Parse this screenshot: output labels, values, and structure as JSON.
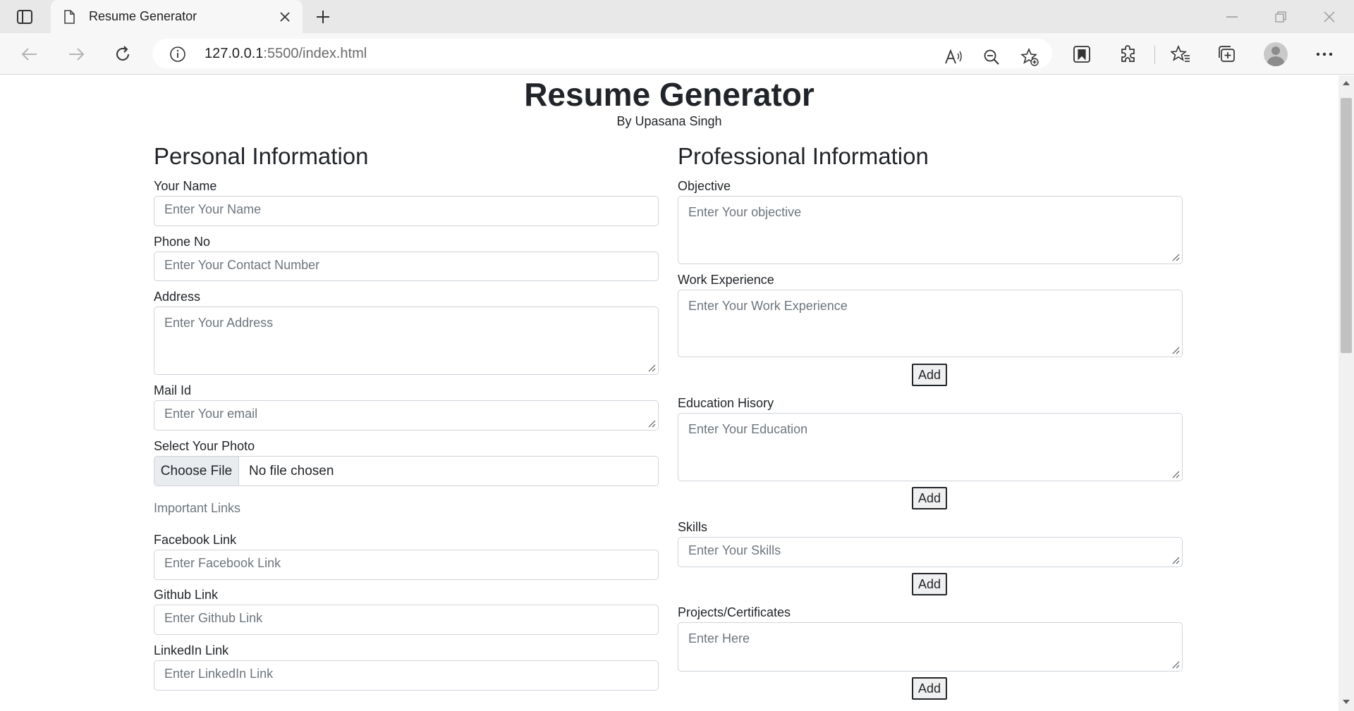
{
  "browser": {
    "tab_title": "Resume Generator",
    "url_host": "127.0.0.1",
    "url_rest": ":5500/index.html"
  },
  "page": {
    "title": "Resume Generator",
    "byline": "By Upasana Singh"
  },
  "personal": {
    "heading": "Personal Information",
    "name_label": "Your Name",
    "name_placeholder": "Enter Your Name",
    "phone_label": "Phone No",
    "phone_placeholder": "Enter Your Contact Number",
    "address_label": "Address",
    "address_placeholder": "Enter Your Address",
    "mail_label": "Mail Id",
    "mail_placeholder": "Enter Your email",
    "photo_label": "Select Your Photo",
    "choose_file_label": "Choose File",
    "no_file_text": "No file chosen",
    "links_heading": "Important Links",
    "facebook_label": "Facebook Link",
    "facebook_placeholder": "Enter Facebook Link",
    "github_label": "Github Link",
    "github_placeholder": "Enter Github Link",
    "linkedin_label": "LinkedIn Link",
    "linkedin_placeholder": "Enter LinkedIn Link"
  },
  "professional": {
    "heading": "Professional Information",
    "objective_label": "Objective",
    "objective_placeholder": "Enter Your objective",
    "work_label": "Work Experience",
    "work_placeholder": "Enter Your Work Experience",
    "education_label": "Education Hisory",
    "education_placeholder": "Enter Your Education",
    "skills_label": "Skills",
    "skills_placeholder": "Enter Your Skills",
    "projects_label": "Projects/Certificates",
    "projects_placeholder": "Enter Here",
    "add_label": "Add"
  }
}
